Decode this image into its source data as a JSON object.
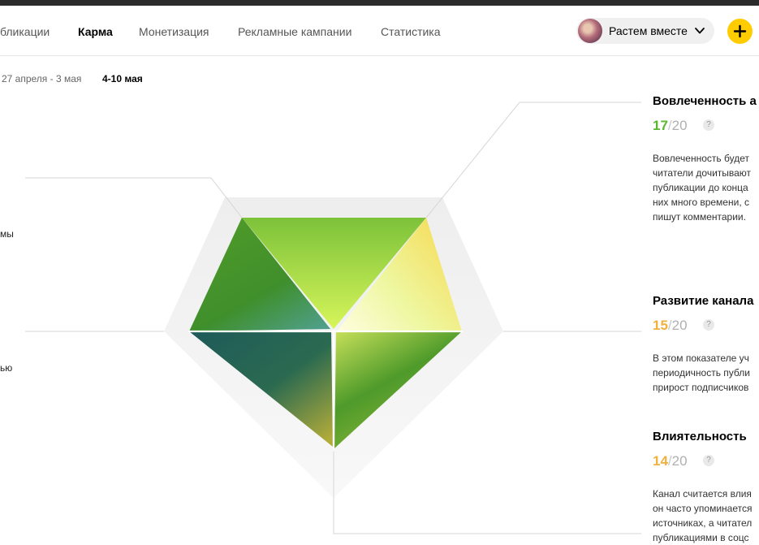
{
  "nav": {
    "items": [
      "бликации",
      "Карма",
      "Монетизация",
      "Рекламные кампании",
      "Статистика"
    ],
    "active_index": 1
  },
  "account": {
    "name": "Растем вместе"
  },
  "periods": {
    "items": [
      "27 апреля - 3 мая",
      "4-10 мая"
    ],
    "active_index": 1
  },
  "side_labels": [
    "мы",
    "ью"
  ],
  "metrics": [
    {
      "title": "Вовлеченность а",
      "score": "17",
      "max": "20",
      "sep": "/",
      "help": "?",
      "color": "#5ab82e",
      "description": [
        "Вовлеченность будет",
        "читатели дочитывают",
        "публикации до конца",
        "них много времени, с",
        "пишут комментарии."
      ]
    },
    {
      "title": "Развитие канала",
      "score": "15",
      "max": "20",
      "sep": "/",
      "help": "?",
      "color": "#f2b03c",
      "description": [
        "В этом показателе уч",
        "периодичность публи",
        "прирост подписчиков"
      ]
    },
    {
      "title": "Влиятельность",
      "score": "14",
      "max": "20",
      "sep": "/",
      "help": "?",
      "color": "#f2b03c",
      "description": [
        "Канал считается влия",
        "он часто упоминается",
        "источниках, а читател",
        "публикациями в соцс"
      ]
    }
  ],
  "colors": {
    "accent": "#ffcc00",
    "good": "#5ab82e",
    "medium": "#f2b03c"
  }
}
